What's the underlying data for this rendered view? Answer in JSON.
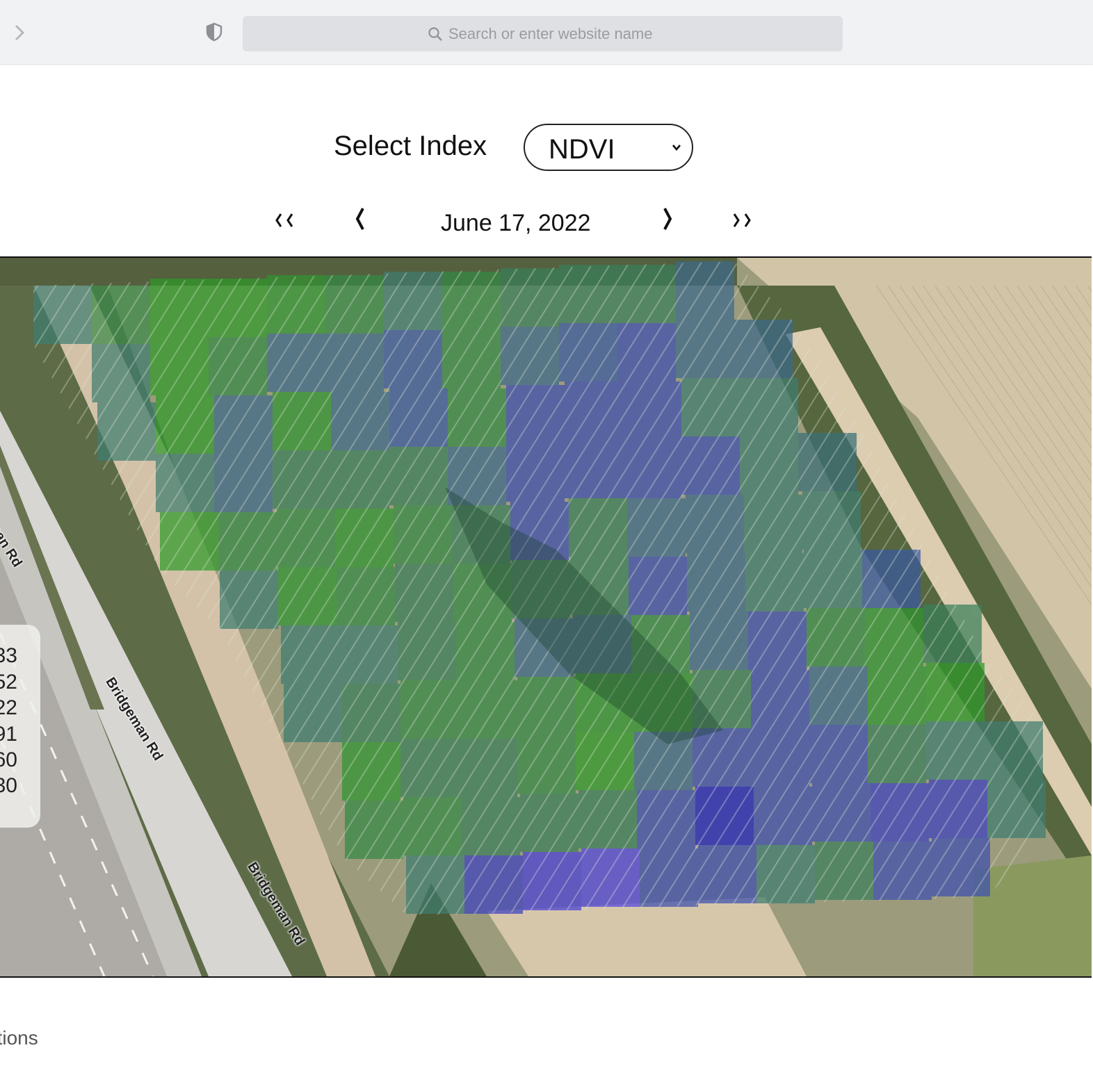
{
  "browser": {
    "forward_icon": "chevron-right-icon",
    "shield_icon": "shield-icon",
    "search_icon": "magnifier-icon",
    "address_placeholder": "Search or enter website name"
  },
  "index_selector": {
    "label": "Select Index",
    "selected": "NDVI"
  },
  "date_nav": {
    "first_label": "‹‹",
    "prev_label": "‹",
    "date": "June 17, 2022",
    "next_label": "›",
    "last_label": "››"
  },
  "map": {
    "road_labels": [
      "nan Rd",
      "Bridgeman Rd",
      "Bridgeman Rd"
    ],
    "legend_values": [
      "33",
      "52",
      "22",
      "91",
      "60",
      "30"
    ],
    "colors": {
      "high": "#2f9a2a",
      "mid": "#3f7d70",
      "low": "#3d3fc4"
    }
  },
  "footer": {
    "options_label": "ptions"
  }
}
